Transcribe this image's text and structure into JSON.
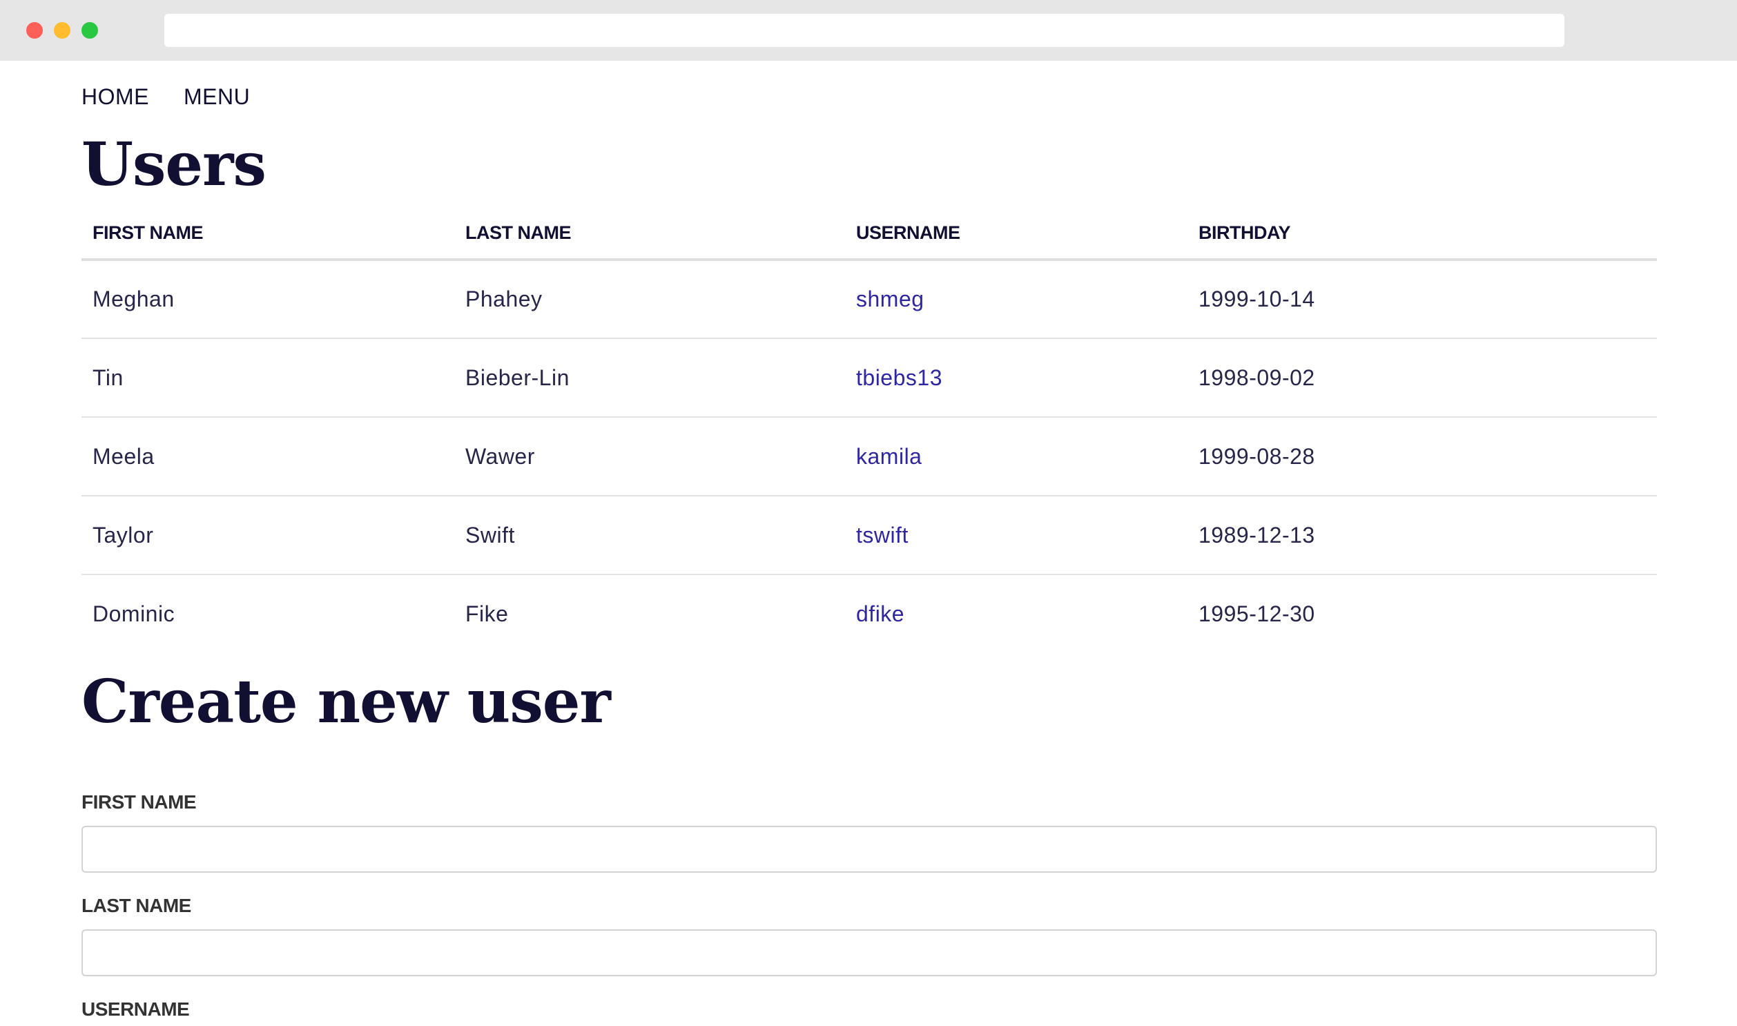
{
  "nav": {
    "home_label": "HOME",
    "menu_label": "MENU"
  },
  "users_title": "Users",
  "table": {
    "headers": [
      "FIRST NAME",
      "LAST NAME",
      "USERNAME",
      "BIRTHDAY"
    ],
    "rows": [
      {
        "first": "Meghan",
        "last": "Phahey",
        "username": "shmeg",
        "birthday": "1999-10-14"
      },
      {
        "first": "Tin",
        "last": "Bieber-Lin",
        "username": "tbiebs13",
        "birthday": "1998-09-02"
      },
      {
        "first": "Meela",
        "last": "Wawer",
        "username": "kamila",
        "birthday": "1999-08-28"
      },
      {
        "first": "Taylor",
        "last": "Swift",
        "username": "tswift",
        "birthday": "1989-12-13"
      },
      {
        "first": "Dominic",
        "last": "Fike",
        "username": "dfike",
        "birthday": "1995-12-30"
      }
    ]
  },
  "create_title": "Create new user",
  "form": {
    "first_name_label": "FIRST NAME",
    "first_name_value": "",
    "last_name_label": "LAST NAME",
    "last_name_value": "",
    "username_label": "USERNAME"
  },
  "colors": {
    "text": "#121032",
    "link": "#2e26a3",
    "chrome": "#e6e6e6"
  }
}
